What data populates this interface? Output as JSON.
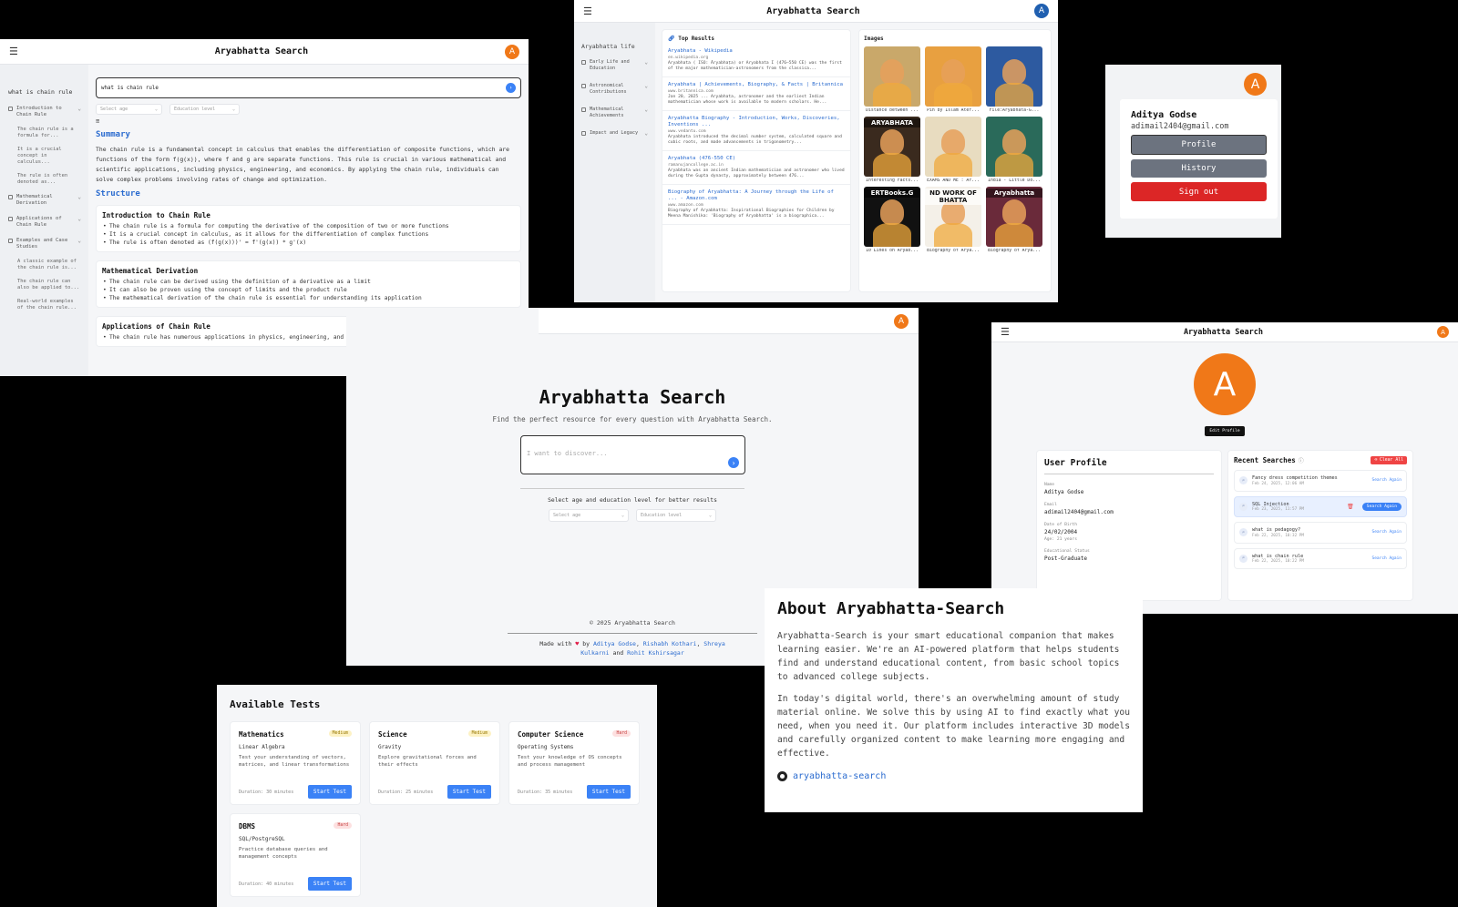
{
  "app": {
    "title": "Aryabhatta Search",
    "avatar_letter": "A"
  },
  "search_panel": {
    "history_query": "what is chain rule",
    "sidebar": [
      {
        "label": "Introduction to Chain Rule",
        "subs": [
          "The chain rule is a formula for...",
          "It is a crucial concept in calculus...",
          "The rule is often denoted as..."
        ]
      },
      {
        "label": "Mathematical Derivation",
        "subs": []
      },
      {
        "label": "Applications of Chain Rule",
        "subs": []
      },
      {
        "label": "Examples and Case Studies",
        "subs": [
          "A classic example of the chain rule is...",
          "The chain rule can also be applied to...",
          "Real-world examples of the chain rule..."
        ]
      }
    ],
    "query_value": "what is chain rule",
    "age_placeholder": "Select age",
    "edu_placeholder": "Education level",
    "summary_heading": "Summary",
    "summary_text": "The chain rule is a fundamental concept in calculus that enables the differentiation of composite functions, which are functions of the form f(g(x)), where f and g are separate functions. This rule is crucial in various mathematical and scientific applications, including physics, engineering, and economics. By applying the chain rule, individuals can solve complex problems involving rates of change and optimization.",
    "structure_heading": "Structure",
    "sections": [
      {
        "title": "Introduction to Chain Rule",
        "points": [
          "The chain rule is a formula for computing the derivative of the composition of two or more functions",
          "It is a crucial concept in calculus, as it allows for the differentiation of complex functions",
          "The rule is often denoted as (f(g(x)))' = f'(g(x)) * g'(x)"
        ]
      },
      {
        "title": "Mathematical Derivation",
        "points": [
          "The chain rule can be derived using the definition of a derivative as a limit",
          "It can also be proven using the concept of limits and the product rule",
          "The mathematical derivation of the chain rule is essential for understanding its application"
        ]
      },
      {
        "title": "Applications of Chain Rule",
        "points": [
          "The chain rule has numerous applications in physics, engineering, and economics"
        ]
      }
    ]
  },
  "results_panel": {
    "sidebar_title": "Aryabhatta life",
    "sidebar": [
      "Early Life and Education",
      "Astronomical Contributions",
      "Mathematical Achievements",
      "Impact and Legacy"
    ],
    "top_results_heading": "Top Results",
    "results": [
      {
        "title": "Aryabhata - Wikipedia",
        "url": "en.wikipedia.org",
        "desc": "Aryabhata ( ISO: Āryabhaṭa) or Aryabhata I (476–550 CE) was the first of the major mathematician-astronomers from the classica..."
      },
      {
        "title": "Aryabhata | Achievements, Biography, & Facts | Britannica",
        "url": "www.britannica.com",
        "desc": "Jan 20, 2025 ... Aryabhata, astronomer and the earliest Indian mathematician whose work is available to modern scholars. He..."
      },
      {
        "title": "Aryabhatta Biography - Introduction, Works, Discoveries, Inventions ...",
        "url": "www.vedantu.com",
        "desc": "Aryabhata introduced the decimal number system, calculated square and cubic roots, and made advancements in trigonometry..."
      },
      {
        "title": "Aryabhata (476-550 CE)",
        "url": "ramanujancollege.ac.in",
        "desc": "Aryabhata was an ancient Indian mathematician and astronomer who lived during the Gupta dynasty, approximately between 476..."
      },
      {
        "title": "Biography of Aryabhatta: A Journey through the Life of ... - Amazon.com",
        "url": "www.amazon.com",
        "desc": "Biography of Aryabhatta: Inspirational Biographies for Children by Meena Manishika: 'Biography of Aryabhatta' is a biographica..."
      }
    ],
    "images_heading": "Images",
    "images": [
      {
        "caption": "Distance between ...",
        "overlay": "",
        "bg": "#c9a86a"
      },
      {
        "caption": "Pin by Islam Atef...",
        "overlay": "",
        "bg": "#e8a040"
      },
      {
        "caption": "File:Aryabhata-G...",
        "overlay": "",
        "bg": "#2d5aa0"
      },
      {
        "caption": "Interesting Facts...",
        "overlay": "ARYABHATA",
        "bg": "#3a2a1e"
      },
      {
        "caption": "EXAMS AND ME : Ar...",
        "overlay": "",
        "bg": "#e8dcc0"
      },
      {
        "caption": "India - Little Do...",
        "overlay": "",
        "bg": "#2a6a5a"
      },
      {
        "caption": "10 Lines on Aryab...",
        "overlay": "ERTBooks.G",
        "bg": "#111111"
      },
      {
        "caption": "Biography of Arya...",
        "overlay": "ND WORK OF BHATTA",
        "bg": "#f4f0e8"
      },
      {
        "caption": "Biography of Arya...",
        "overlay": "Aryabhatta",
        "bg": "#6a2a3a"
      }
    ]
  },
  "profile_menu": {
    "name": "Aditya Godse",
    "email": "adimail2404@gmail.com",
    "profile_btn": "Profile",
    "history_btn": "History",
    "signout_btn": "Sign out"
  },
  "home_panel": {
    "title": "Aryabhatta Search",
    "subtitle": "Find the perfect resource for every question with Aryabhatta Search.",
    "placeholder": "I want to discover...",
    "hint": "Select age and education level for better results",
    "age_placeholder": "Select age",
    "edu_placeholder": "Education level",
    "copyright": "© 2025 Aryabhatta Search",
    "made_with": "Made with",
    "heart": "♥",
    "by": "by",
    "authors": [
      "Aditya Godse",
      "Rishabh Kothari",
      "Shreya Kulkarni",
      "Rohit Kshirsagar"
    ],
    "and": "and"
  },
  "user_profile": {
    "avatar_letter": "A",
    "edit_btn": "Edit Profile",
    "heading": "User Profile",
    "name_label": "Name",
    "name": "Aditya Godse",
    "email_label": "Email",
    "email": "adimail2404@gmail.com",
    "dob_label": "Date of Birth",
    "dob": "24/02/2004",
    "age": "Age: 21 years",
    "edu_label": "Educational Status",
    "edu": "Post-Graduate",
    "recent_heading": "Recent Searches",
    "clear_btn": "Clear All",
    "recent": [
      {
        "query": "Fancy dress competition themes",
        "date": "Feb 24, 2025, 12:06 AM",
        "action": "Search Again"
      },
      {
        "query": "SQL Injection",
        "date": "Feb 23, 2025, 11:57 PM",
        "action": "Search Again"
      },
      {
        "query": "what is pedagogy?",
        "date": "Feb 22, 2025, 10:32 PM",
        "action": "Search Again"
      },
      {
        "query": "what is chain rule",
        "date": "Feb 22, 2025, 10:22 PM",
        "action": "Search Again"
      }
    ]
  },
  "about": {
    "heading": "About Aryabhatta-Search",
    "p1": "Aryabhatta-Search is your smart educational companion that makes learning easier. We're an AI-powered platform that helps students find and understand educational content, from basic school topics to advanced college subjects.",
    "p2": "In today's digital world, there's an overwhelming amount of study material online. We solve this by using AI to find exactly what you need, when you need it. Our platform includes interactive 3D models and carefully organized content to make learning more engaging and effective.",
    "repo": "aryabhatta-search"
  },
  "tests": {
    "heading": "Available Tests",
    "items": [
      {
        "subject": "Mathematics",
        "level": "Medium",
        "topic": "Linear Algebra",
        "desc": "Test your understanding of vectors, matrices, and linear transformations",
        "duration": "Duration: 30 minutes",
        "action": "Start Test"
      },
      {
        "subject": "Science",
        "level": "Medium",
        "topic": "Gravity",
        "desc": "Explore gravitational forces and their effects",
        "duration": "Duration: 25 minutes",
        "action": "Start Test"
      },
      {
        "subject": "Computer Science",
        "level": "Hard",
        "topic": "Operating Systems",
        "desc": "Test your knowledge of OS concepts and process management",
        "duration": "Duration: 35 minutes",
        "action": "Start Test"
      },
      {
        "subject": "DBMS",
        "level": "Hard",
        "topic": "SQL/PostgreSQL",
        "desc": "Practice database queries and management concepts",
        "duration": "Duration: 40 minutes",
        "action": "Start Test"
      }
    ]
  }
}
